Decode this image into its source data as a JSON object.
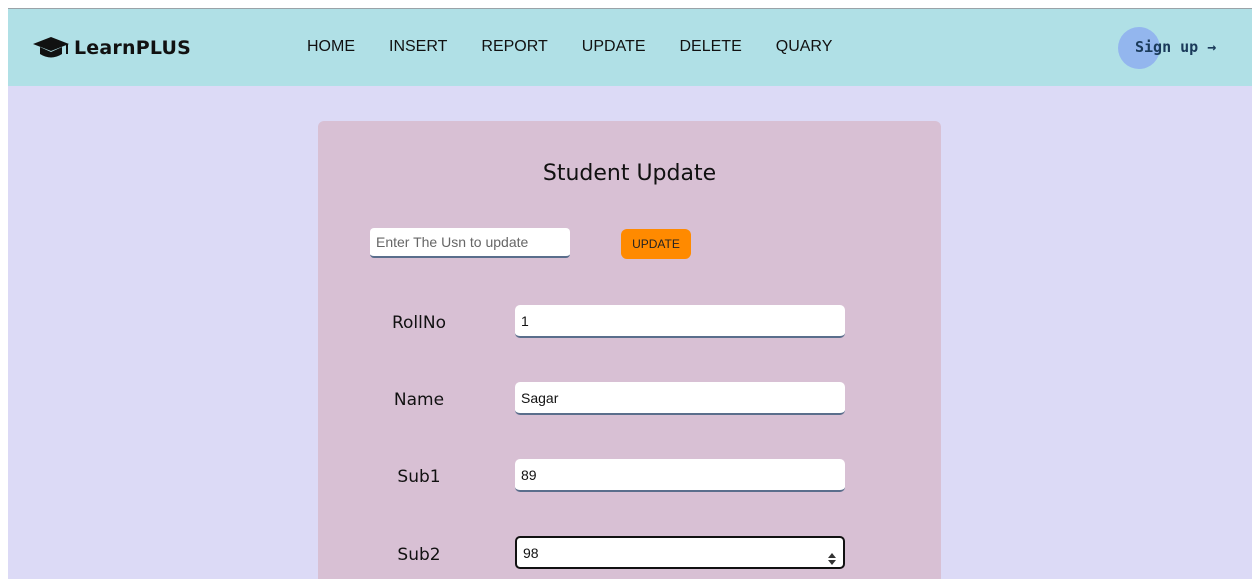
{
  "brand": {
    "name": "LearnPLUS",
    "icon": "graduation-cap-icon"
  },
  "nav": {
    "items": [
      {
        "label": "HOME"
      },
      {
        "label": "INSERT"
      },
      {
        "label": "REPORT"
      },
      {
        "label": "UPDATE"
      },
      {
        "label": "DELETE"
      },
      {
        "label": "QUARY"
      }
    ]
  },
  "signup": {
    "label": "Sign up →"
  },
  "form": {
    "title": "Student Update",
    "usn_placeholder": "Enter The Usn to update",
    "update_button": "UPDATE",
    "fields": [
      {
        "label": "RollNo",
        "value": "1"
      },
      {
        "label": "Name",
        "value": "Sagar"
      },
      {
        "label": "Sub1",
        "value": "89"
      },
      {
        "label": "Sub2",
        "value": "98"
      }
    ]
  },
  "colors": {
    "navbar": "#b0e0e6",
    "page": "#dcdaf6",
    "card": "#d8c0d4",
    "accent": "#ff8a00",
    "signup_circle": "#93b6ee"
  }
}
